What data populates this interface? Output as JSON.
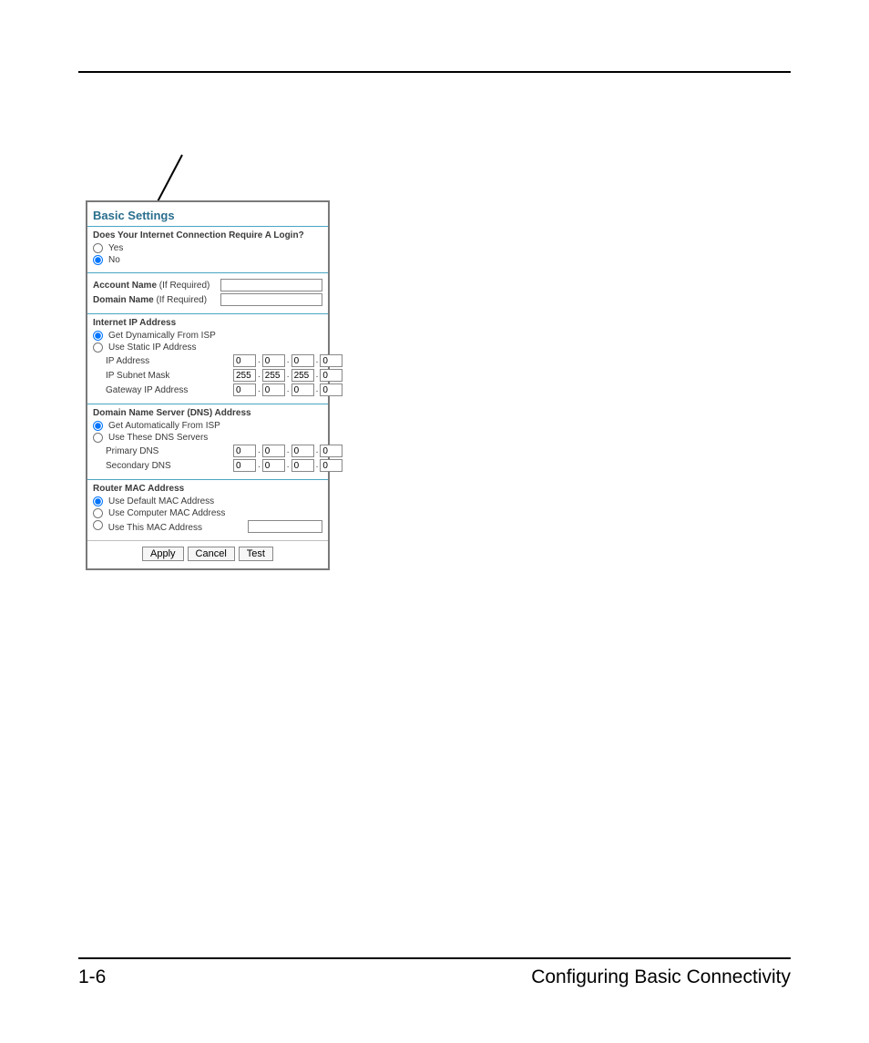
{
  "footer": {
    "page_number": "1-6",
    "chapter_title": "Configuring Basic Connectivity"
  },
  "panel": {
    "title": "Basic Settings",
    "login_section": {
      "question": "Does Your Internet Connection Require A Login?",
      "options": {
        "yes": "Yes",
        "no": "No"
      },
      "selected": "no"
    },
    "account_section": {
      "account_name_label": "Account Name",
      "account_name_note": "(If Required)",
      "domain_name_label": "Domain Name",
      "domain_name_note": "(If Required)",
      "account_name_value": "",
      "domain_name_value": ""
    },
    "ip_section": {
      "heading": "Internet IP Address",
      "options": {
        "dynamic": "Get Dynamically From ISP",
        "static": "Use Static IP Address"
      },
      "selected": "dynamic",
      "ip_address_label": "IP Address",
      "ip_subnet_label": "IP Subnet Mask",
      "gateway_label": "Gateway IP Address",
      "ip_address": [
        "0",
        "0",
        "0",
        "0"
      ],
      "ip_subnet": [
        "255",
        "255",
        "255",
        "0"
      ],
      "gateway": [
        "0",
        "0",
        "0",
        "0"
      ]
    },
    "dns_section": {
      "heading": "Domain Name Server (DNS) Address",
      "options": {
        "auto": "Get Automatically From ISP",
        "manual": "Use These DNS Servers"
      },
      "selected": "auto",
      "primary_label": "Primary DNS",
      "secondary_label": "Secondary DNS",
      "primary": [
        "0",
        "0",
        "0",
        "0"
      ],
      "secondary": [
        "0",
        "0",
        "0",
        "0"
      ]
    },
    "mac_section": {
      "heading": "Router MAC Address",
      "options": {
        "default": "Use Default MAC Address",
        "computer": "Use Computer MAC Address",
        "manual": "Use This MAC Address"
      },
      "selected": "default",
      "mac_value": ""
    },
    "buttons": {
      "apply": "Apply",
      "cancel": "Cancel",
      "test": "Test"
    }
  }
}
